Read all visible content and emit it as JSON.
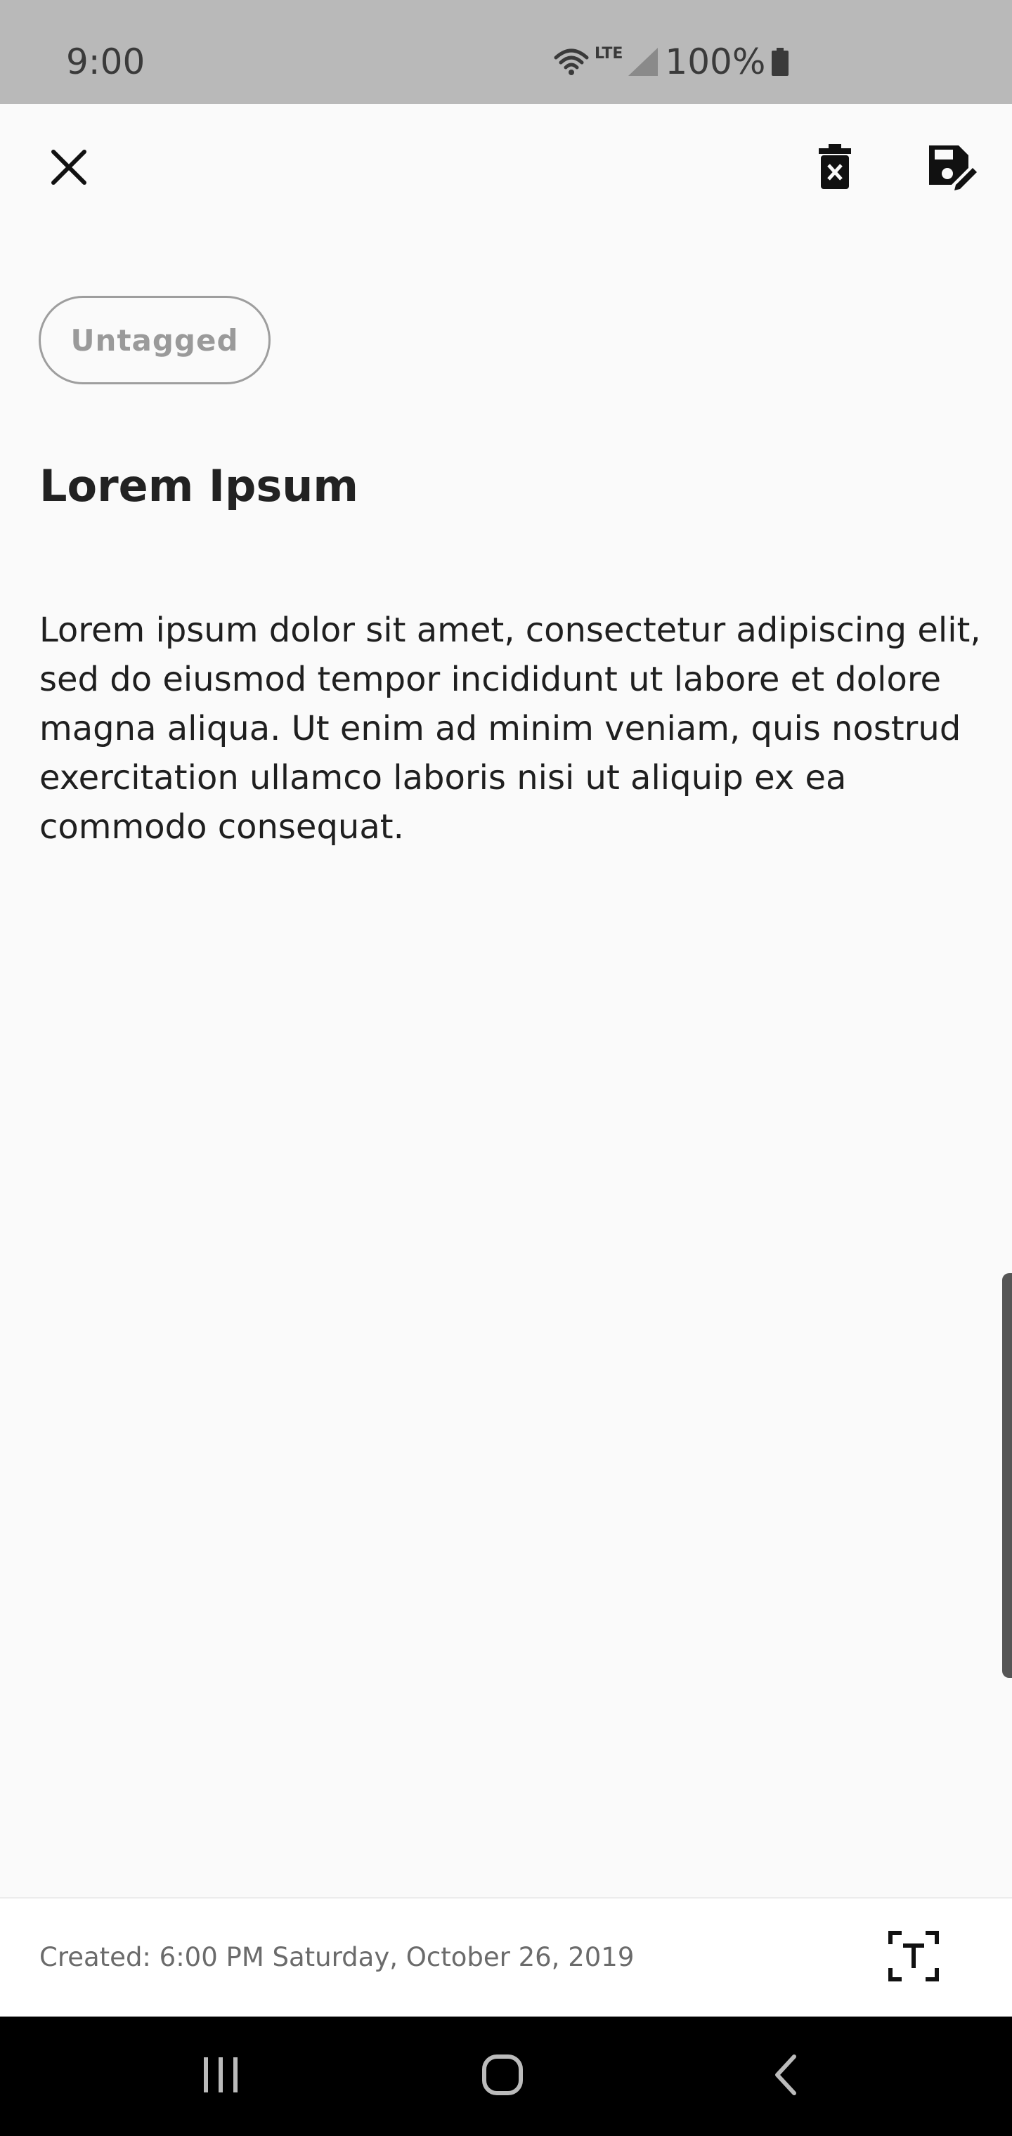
{
  "status_bar": {
    "time": "9:00",
    "network": "LTE",
    "battery": "100%",
    "icons": [
      "wifi-icon",
      "cellular-signal-icon",
      "battery-icon"
    ]
  },
  "toolbar": {
    "close_icon": "close-icon",
    "delete_icon": "delete-note-icon",
    "save_icon": "save-edit-icon"
  },
  "note": {
    "tag": "Untagged",
    "title": "Lorem Ipsum",
    "body": "Lorem ipsum dolor sit amet, consectetur adipiscing elit, sed do eiusmod tempor incididunt ut labore et dolore magna aliqua. Ut enim ad minim veniam, quis nostrud exercitation ullamco laboris nisi ut aliquip ex ea commodo consequat."
  },
  "footer": {
    "created": "Created: 6:00 PM Saturday, October 26, 2019",
    "text_scan_icon": "text-recognition-icon"
  },
  "nav_bar": {
    "icons": [
      "recent-apps-icon",
      "home-icon",
      "back-icon"
    ]
  },
  "colors": {
    "status_bar_bg": "#b9b9b9",
    "page_bg": "#fafafa",
    "footer_bg": "#ffffff",
    "nav_bar_bg": "#000000",
    "tag_border": "#9e9e9e"
  }
}
